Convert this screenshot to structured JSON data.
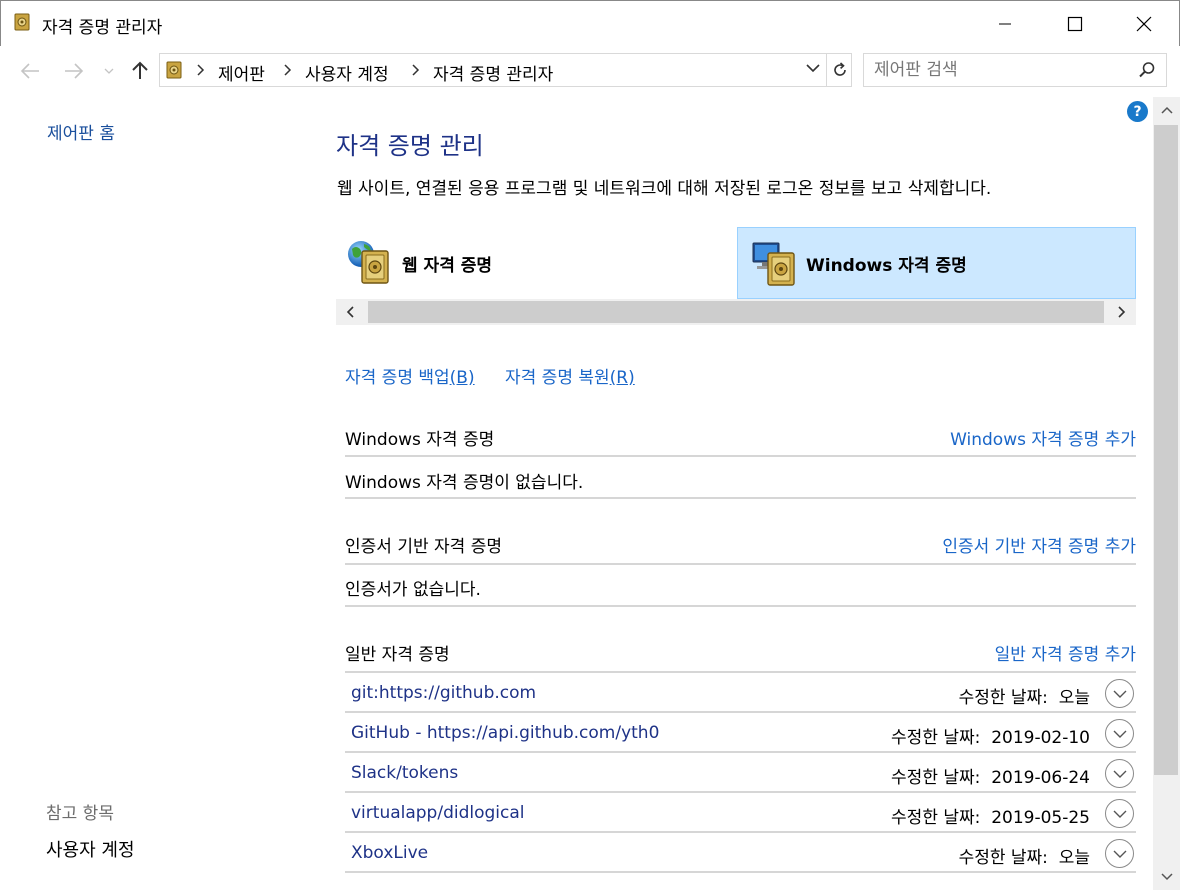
{
  "window": {
    "title": "자격 증명 관리자"
  },
  "address": {
    "crumbs": [
      "제어판",
      "사용자 계정",
      "자격 증명 관리자"
    ]
  },
  "search": {
    "placeholder": "제어판 검색"
  },
  "leftnav": {
    "home": "제어판 홈",
    "see_also": "참고 항목",
    "user_accounts": "사용자 계정"
  },
  "help": {
    "glyph": "?"
  },
  "main": {
    "title": "자격 증명 관리",
    "description": "웹 사이트, 연결된 응용 프로그램 및 네트워크에 대해 저장된 로그온 정보를 보고 삭제합니다.",
    "tabs": [
      {
        "label": "웹 자격 증명",
        "selected": false
      },
      {
        "label": "Windows 자격 증명",
        "selected": true
      }
    ],
    "actions": {
      "backup_prefix": "자격 증명 백업",
      "backup_key": "(B)",
      "restore_prefix": "자격 증명 복원",
      "restore_key": "(R)"
    },
    "sections": {
      "windows": {
        "title": "Windows 자격 증명",
        "add": "Windows 자격 증명 추가",
        "empty": "Windows 자격 증명이 없습니다."
      },
      "certificate": {
        "title": "인증서 기반 자격 증명",
        "add": "인증서 기반 자격 증명 추가",
        "empty": "인증서가 없습니다."
      },
      "generic": {
        "title": "일반 자격 증명",
        "add": "일반 자격 증명 추가",
        "items": [
          {
            "name": "git:https://github.com",
            "date_label": "수정한 날짜:",
            "date": "오늘"
          },
          {
            "name": "GitHub - https://api.github.com/yth0",
            "date_label": "수정한 날짜:",
            "date": "2019-02-10"
          },
          {
            "name": "Slack/tokens",
            "date_label": "수정한 날짜:",
            "date": "2019-06-24"
          },
          {
            "name": "virtualapp/didlogical",
            "date_label": "수정한 날짜:",
            "date": "2019-05-25"
          },
          {
            "name": "XboxLive",
            "date_label": "수정한 날짜:",
            "date": "오늘"
          }
        ]
      }
    }
  },
  "colors": {
    "accent_link": "#1a66c8",
    "title_blue": "#1e3287",
    "selected_tab": "#cce8ff",
    "help_blue": "#1979ca"
  }
}
